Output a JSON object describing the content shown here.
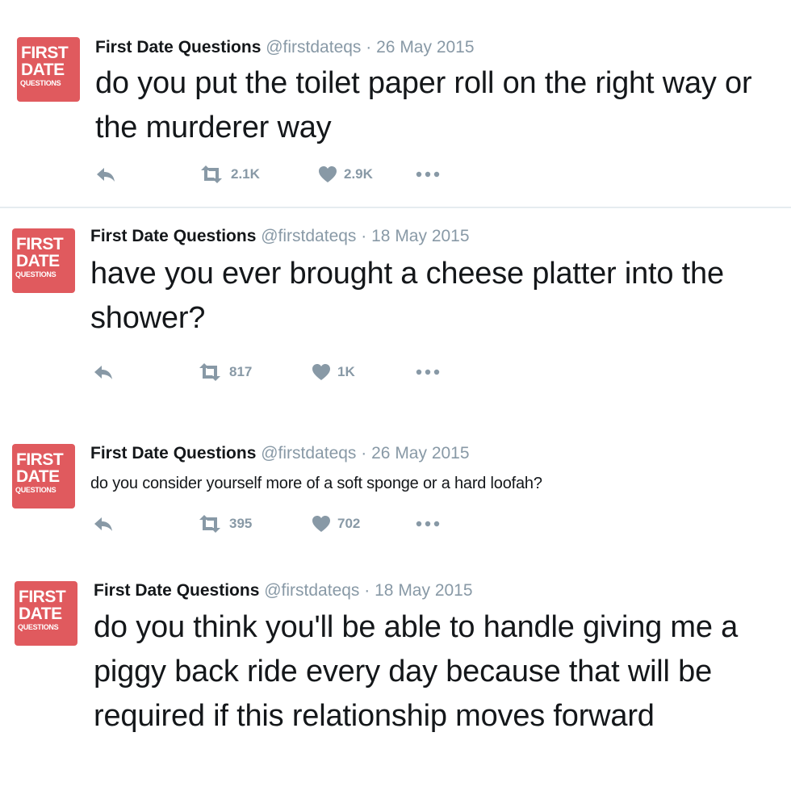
{
  "avatar": {
    "line1": "FIRST",
    "line2": "DATE",
    "line3": "QUESTIONS"
  },
  "tweets": [
    {
      "name": "First Date Questions",
      "handle": "@firstdateqs",
      "separator": "·",
      "date": "26 May 2015",
      "text": "do you put the toilet paper roll on the right way or the murderer way",
      "retweets": "2.1K",
      "likes": "2.9K"
    },
    {
      "name": "First Date Questions",
      "handle": "@firstdateqs",
      "separator": "·",
      "date": "18 May 2015",
      "text": "have you ever brought a cheese platter into the shower?",
      "retweets": "817",
      "likes": "1K"
    },
    {
      "name": "First Date Questions",
      "handle": "@firstdateqs",
      "separator": "·",
      "date": "26 May 2015",
      "text": "do you consider yourself more of a soft sponge or a hard loofah?",
      "retweets": "395",
      "likes": "702"
    },
    {
      "name": "First Date Questions",
      "handle": "@firstdateqs",
      "separator": "·",
      "date": "18 May 2015",
      "text": "do you think you'll be able to handle giving me a piggy back ride every day because that will be required if this relationship moves forward"
    }
  ],
  "icons": {
    "reply": "reply-icon",
    "retweet": "retweet-icon",
    "like": "heart-icon",
    "more": "more-icon"
  },
  "colors": {
    "avatar_bg": "#e05a5e",
    "meta_gray": "#8899a6",
    "text": "#14171a"
  }
}
